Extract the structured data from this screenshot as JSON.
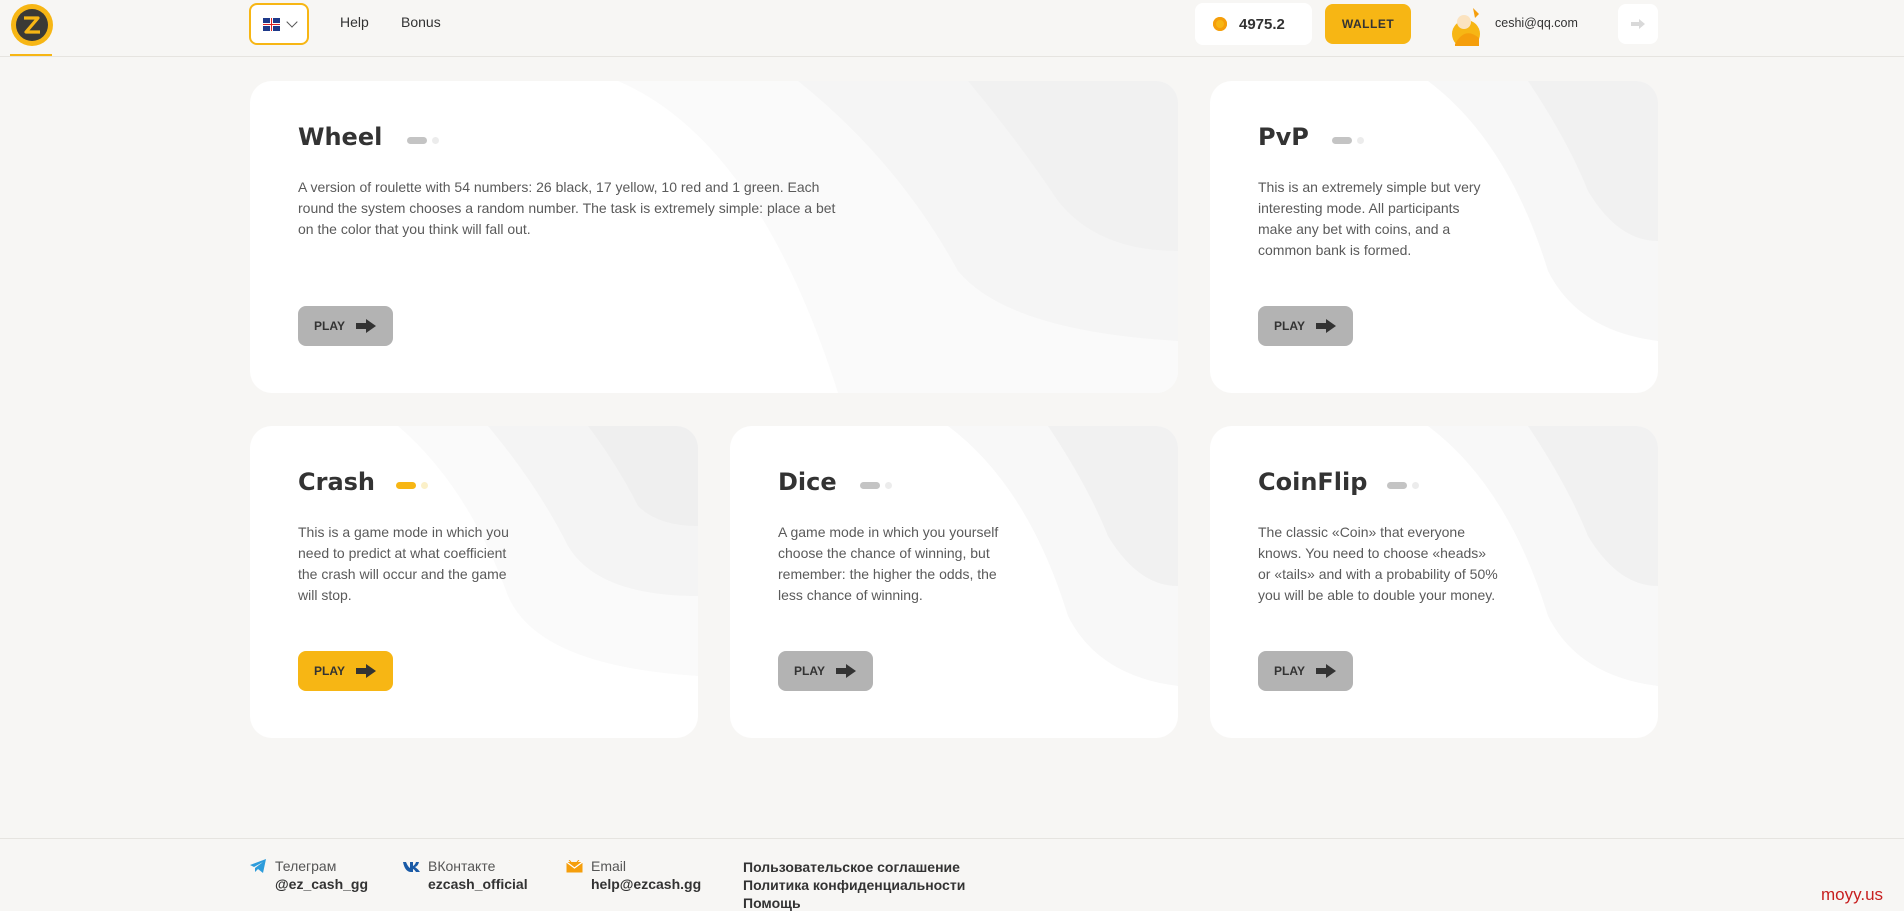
{
  "header": {
    "nav": {
      "help": "Help",
      "bonus": "Bonus"
    },
    "balance": "4975.2",
    "wallet_label": "WALLET",
    "user_email": "ceshi@qq.com",
    "brand_color": "#f7b614"
  },
  "games": [
    {
      "title": "Wheel",
      "description": "A version of roulette with 54 numbers: 26 black, 17 yellow, 10 red and 1 green. Each round the system chooses a random number. The task is extremely simple: place a bet on the color that you think will fall out.",
      "play_label": "PLAY",
      "active": false
    },
    {
      "title": "PvP",
      "description": "This is an extremely simple but very interesting mode. All participants make any bet with coins, and a common bank is formed.",
      "play_label": "PLAY",
      "active": false
    },
    {
      "title": "Crash",
      "description": "This is a game mode in which you need to predict at what coefficient the crash will occur and the game will stop.",
      "play_label": "PLAY",
      "active": true
    },
    {
      "title": "Dice",
      "description": "A game mode in which you yourself choose the chance of winning, but remember: the higher the odds, the less chance of winning.",
      "play_label": "PLAY",
      "active": false
    },
    {
      "title": "CoinFlip",
      "description": "The classic «Coin» that everyone knows. You need to choose «heads» or «tails» and with a probability of 50% you will be able to double your money.",
      "play_label": "PLAY",
      "active": false
    }
  ],
  "footer": {
    "telegram": {
      "label": "Телеграм",
      "value": "@ez_cash_gg"
    },
    "vk": {
      "label": "ВКонтакте",
      "value": "ezcash_official"
    },
    "email": {
      "label": "Email",
      "value": "help@ezcash.gg"
    },
    "links": [
      "Пользовательское соглашение",
      "Политика конфиденциальности",
      "Помощь"
    ]
  },
  "watermark": "moyy.us"
}
